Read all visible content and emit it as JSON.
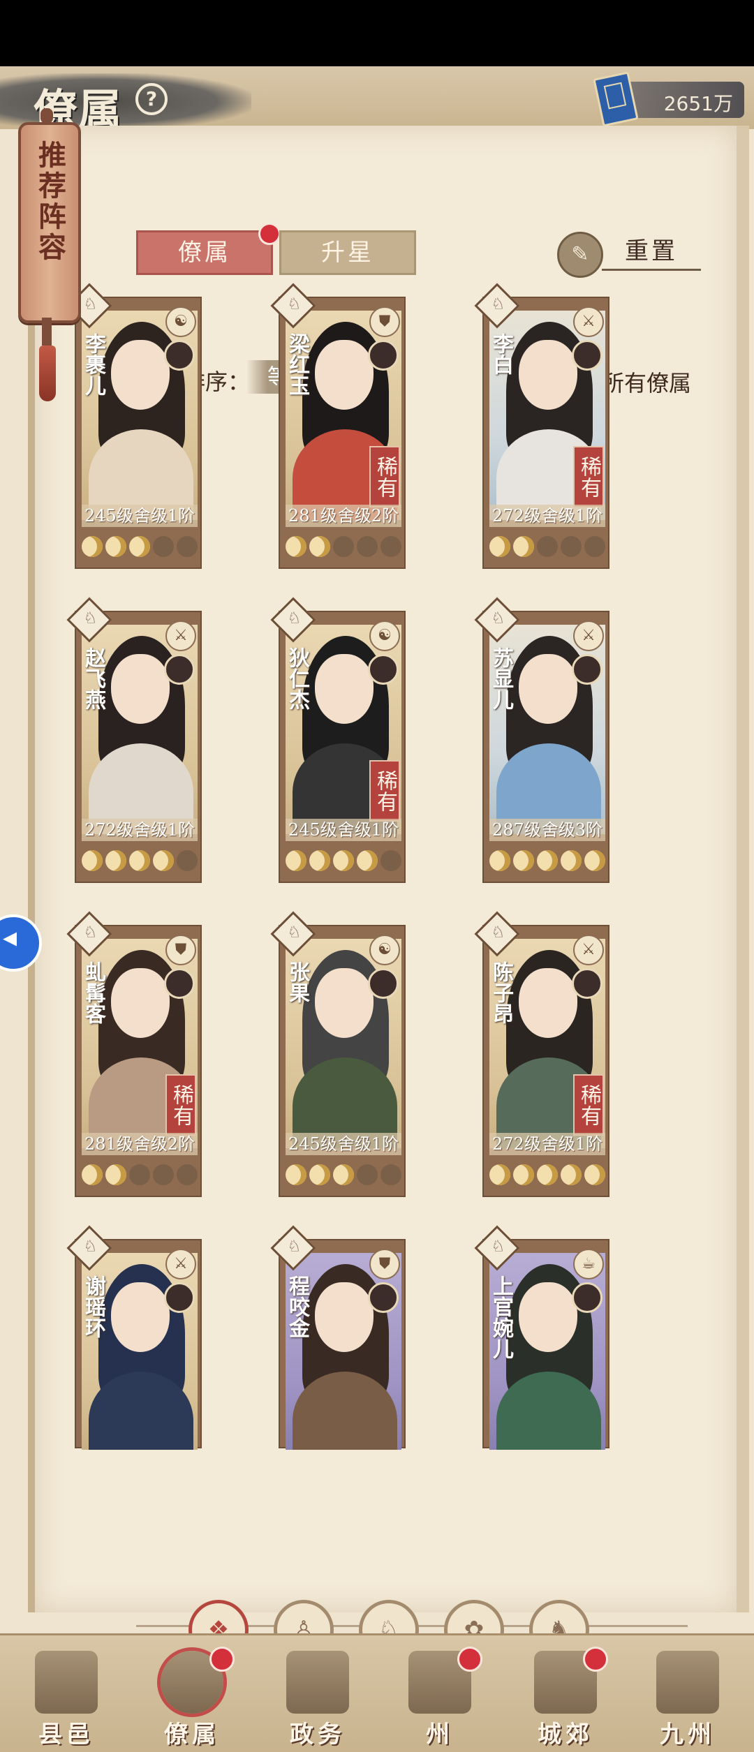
{
  "header": {
    "title": "僚属",
    "currency_value": "2651万"
  },
  "scroll": {
    "label": "推荐阵容"
  },
  "tabs": [
    {
      "label": "僚属"
    },
    {
      "label": "升星"
    }
  ],
  "reset_label": "重置",
  "sort": {
    "label": "僚属排序：",
    "value": "等级"
  },
  "show_all": {
    "label": "显示所有僚属",
    "checked": true
  },
  "cards": [
    {
      "name": "李裹儿",
      "level": "245级",
      "grade": "舍级1阶",
      "rare": "",
      "moons": 3
    },
    {
      "name": "梁红玉",
      "level": "281级",
      "grade": "舍级2阶",
      "rare": "稀有",
      "moons": 2
    },
    {
      "name": "李白",
      "level": "272级",
      "grade": "舍级1阶",
      "rare": "稀有",
      "moons": 2
    },
    {
      "name": "赵飞燕",
      "level": "272级",
      "grade": "舍级1阶",
      "rare": "",
      "moons": 4
    },
    {
      "name": "狄仁杰",
      "level": "245级",
      "grade": "舍级1阶",
      "rare": "稀有",
      "moons": 4
    },
    {
      "name": "苏显儿",
      "level": "287级",
      "grade": "舍级3阶",
      "rare": "",
      "moons": 5
    },
    {
      "name": "虬髯客",
      "level": "281级",
      "grade": "舍级2阶",
      "rare": "稀有",
      "moons": 2
    },
    {
      "name": "张果",
      "level": "245级",
      "grade": "舍级1阶",
      "rare": "",
      "moons": 3
    },
    {
      "name": "陈子昂",
      "level": "272级",
      "grade": "舍级1阶",
      "rare": "稀有",
      "moons": 5
    },
    {
      "name": "谢瑶环",
      "level": "",
      "grade": "",
      "rare": "",
      "moons": 0
    },
    {
      "name": "程咬金",
      "level": "",
      "grade": "",
      "rare": "",
      "moons": 0
    },
    {
      "name": "上官婉儿",
      "level": "",
      "grade": "",
      "rare": "",
      "moons": 0
    }
  ],
  "nav": [
    {
      "label": "县邑"
    },
    {
      "label": "僚属"
    },
    {
      "label": "政务"
    },
    {
      "label": "州"
    },
    {
      "label": "城郊"
    },
    {
      "label": "九州"
    }
  ]
}
